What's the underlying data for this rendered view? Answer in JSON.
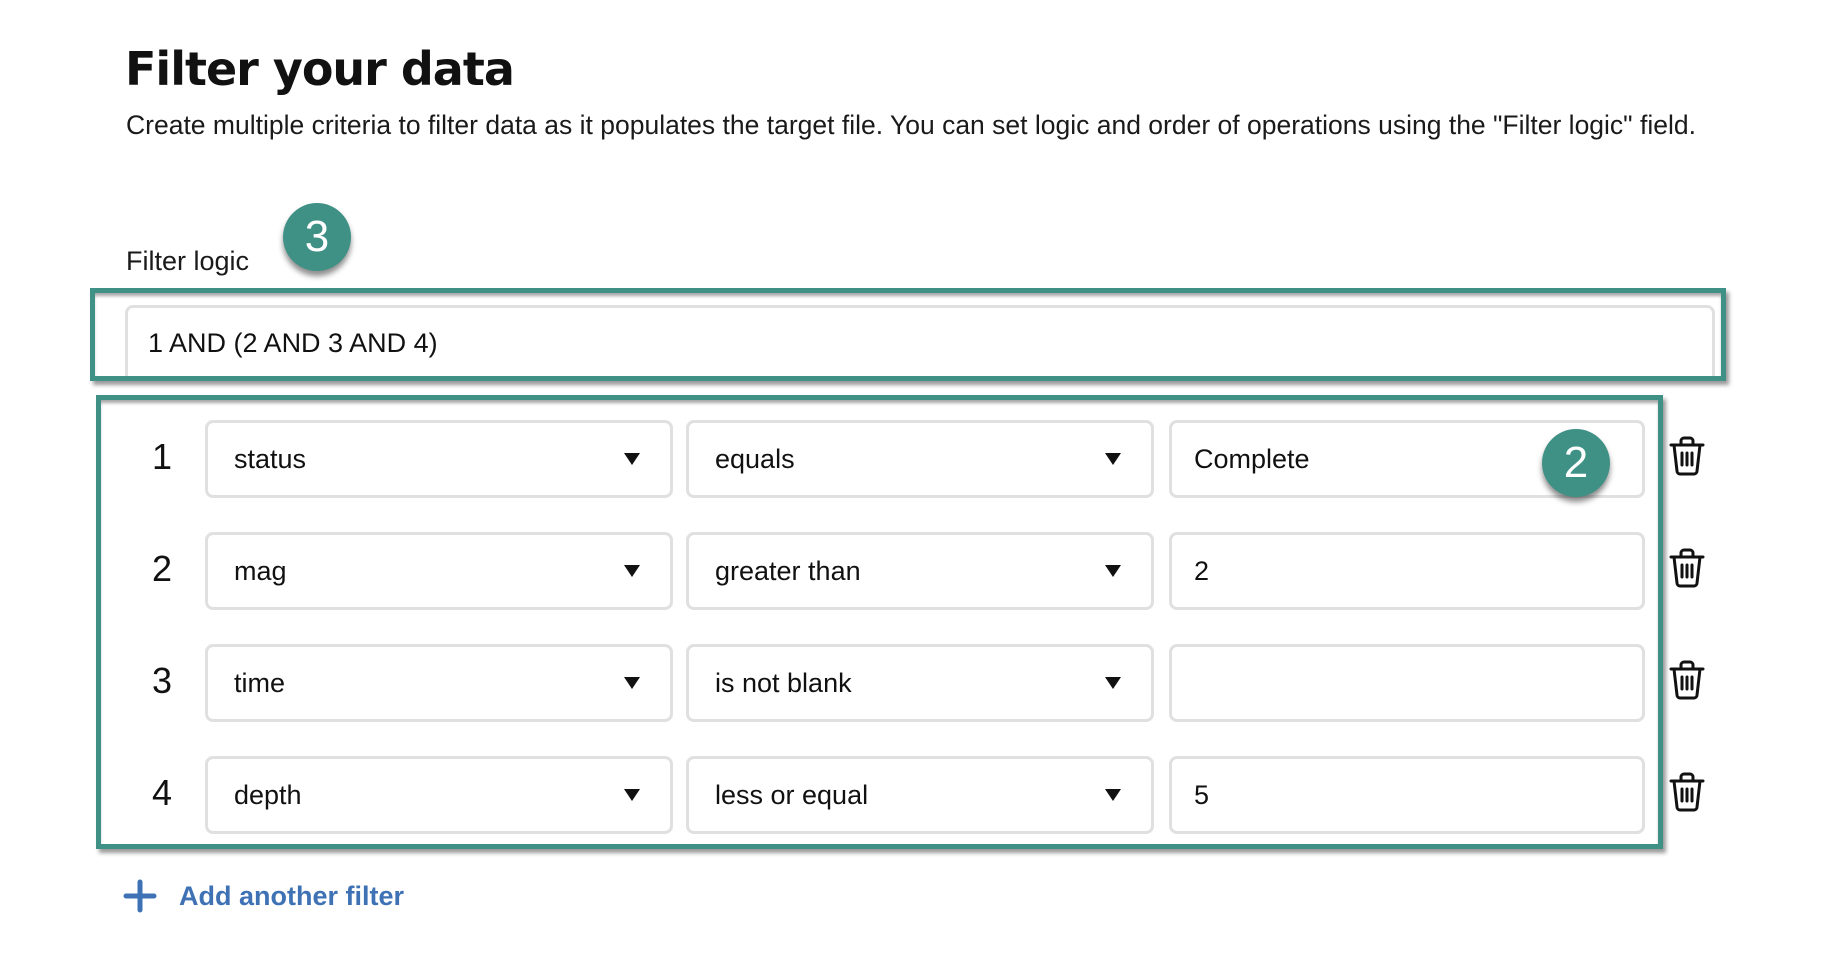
{
  "page": {
    "title": "Filter your data",
    "description": "Create multiple criteria to filter data as it populates the target file. You can set logic and order of operations using the \"Filter logic\" field."
  },
  "filter_logic": {
    "label": "Filter logic",
    "value": "1 AND (2 AND 3 AND 4)"
  },
  "callouts": {
    "logic_badge": "3",
    "rows_badge": "2"
  },
  "filters": [
    {
      "number": "1",
      "field": "status",
      "operator": "equals",
      "value": "Complete"
    },
    {
      "number": "2",
      "field": "mag",
      "operator": "greater than",
      "value": "2"
    },
    {
      "number": "3",
      "field": "time",
      "operator": "is not blank",
      "value": ""
    },
    {
      "number": "4",
      "field": "depth",
      "operator": "less or equal",
      "value": "5"
    }
  ],
  "icons": {
    "dropdown": "caret-down-icon",
    "delete": "trash-icon",
    "add": "plus-icon"
  },
  "add_filter": {
    "label": "Add another filter"
  },
  "colors": {
    "highlight": "#3f9085",
    "link": "#3f72b5",
    "field_border": "#e0e0e0",
    "text": "#111111"
  }
}
